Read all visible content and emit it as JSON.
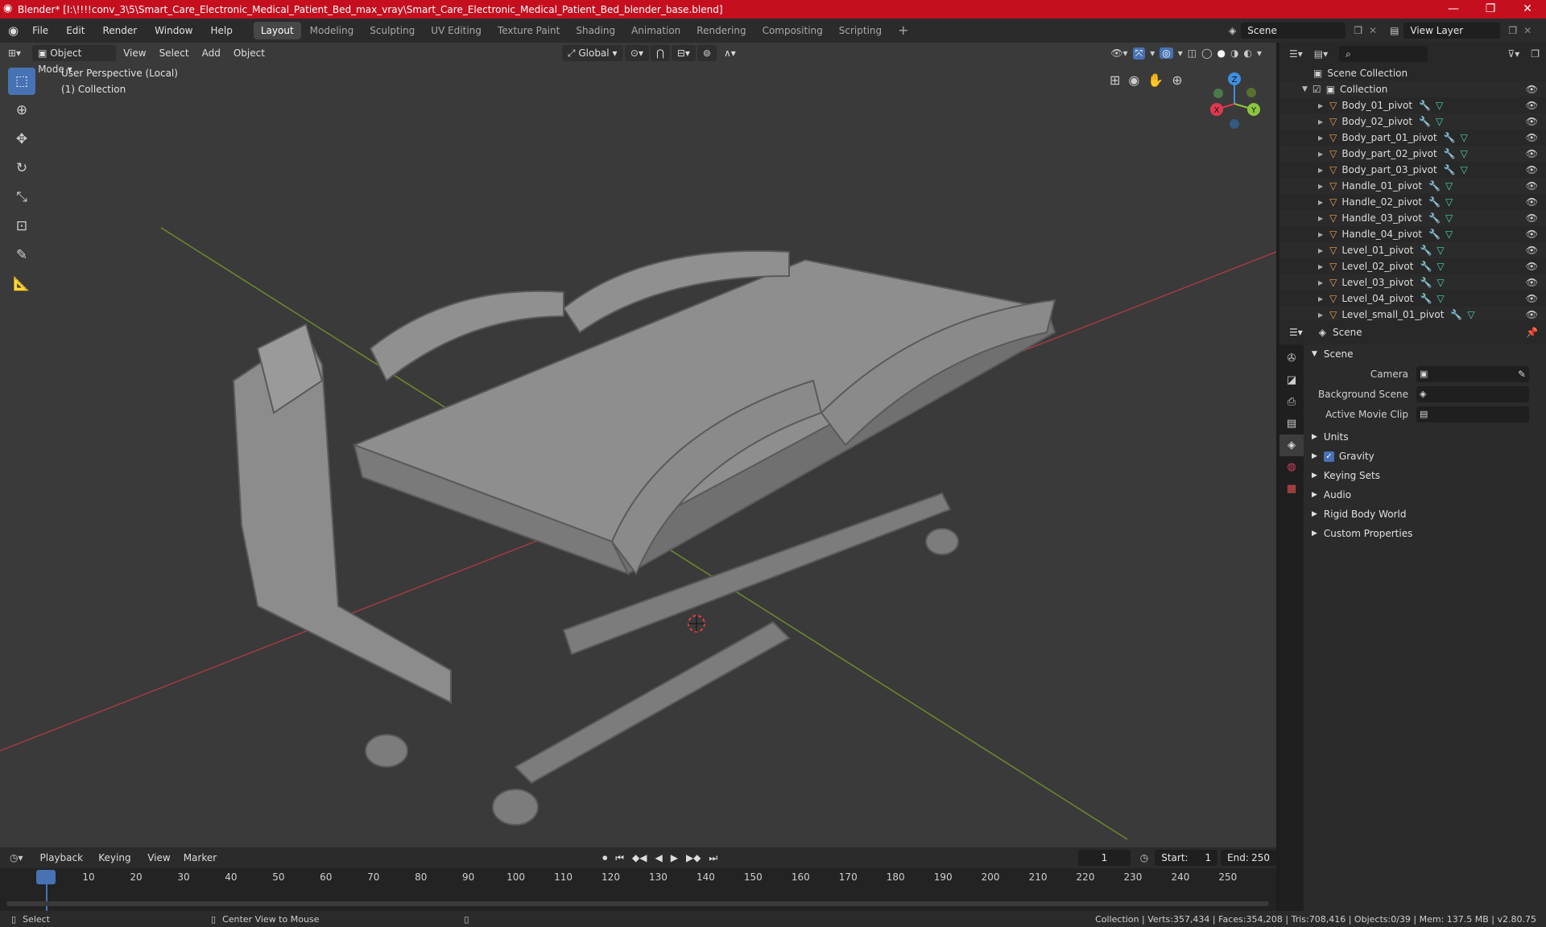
{
  "titlebar": {
    "title": "Blender* [I:\\!!!!conv_3\\5\\Smart_Care_Electronic_Medical_Patient_Bed_max_vray\\Smart_Care_Electronic_Medical_Patient_Bed_blender_base.blend]",
    "minimize": "—",
    "maximize": "❐",
    "close": "✕"
  },
  "menus": [
    "File",
    "Edit",
    "Render",
    "Window",
    "Help"
  ],
  "workspaces": [
    "Layout",
    "Modeling",
    "Sculpting",
    "UV Editing",
    "Texture Paint",
    "Shading",
    "Animation",
    "Rendering",
    "Compositing",
    "Scripting"
  ],
  "active_workspace": "Layout",
  "add_workspace": "+",
  "scene_field": "Scene",
  "view_layer_field": "View Layer",
  "viewport": {
    "mode": "Object Mode",
    "menus": [
      "View",
      "Select",
      "Add",
      "Object"
    ],
    "orientation": "Global",
    "perspective_label": "User Perspective (Local)",
    "collection_label": "(1) Collection",
    "gizmo": {
      "x": "X",
      "y": "Y",
      "z": "Z"
    }
  },
  "outliner": {
    "search_placeholder": "",
    "scene_collection": "Scene Collection",
    "collection": "Collection",
    "objects": [
      "Body_01_pivot",
      "Body_02_pivot",
      "Body_part_01_pivot",
      "Body_part_02_pivot",
      "Body_part_03_pivot",
      "Handle_01_pivot",
      "Handle_02_pivot",
      "Handle_03_pivot",
      "Handle_04_pivot",
      "Level_01_pivot",
      "Level_02_pivot",
      "Level_03_pivot",
      "Level_04_pivot",
      "Level_small_01_pivot"
    ]
  },
  "properties": {
    "header": "Scene",
    "panel": "Scene",
    "camera_label": "Camera",
    "background_scene_label": "Background Scene",
    "active_movie_clip_label": "Active Movie Clip",
    "sections": [
      "Units",
      "Gravity",
      "Keying Sets",
      "Audio",
      "Rigid Body World",
      "Custom Properties"
    ],
    "gravity_checked": true
  },
  "timeline": {
    "menus": [
      "Playback",
      "Keying",
      "View",
      "Marker"
    ],
    "current_frame": "1",
    "start_label": "Start:",
    "start": "1",
    "end_label": "End:",
    "end": "250",
    "ticks": [
      "1",
      "10",
      "20",
      "30",
      "40",
      "50",
      "60",
      "70",
      "80",
      "90",
      "100",
      "110",
      "120",
      "130",
      "140",
      "150",
      "160",
      "170",
      "180",
      "190",
      "200",
      "210",
      "220",
      "230",
      "240",
      "250"
    ]
  },
  "statusbar": {
    "select": "Select",
    "center_view": "Center View to Mouse",
    "stats": "Collection | Verts:357,434 | Faces:354,208 | Tris:708,416 | Objects:0/39 | Mem: 137.5 MB | v2.80.75"
  },
  "colors": {
    "titlebar": "#c50f1f",
    "accent": "#4772b3",
    "object_icon": "#f0a050",
    "modifier_icon": "#6aa7e8",
    "mesh_icon": "#4ad7b0",
    "axis_x": "#e0394f",
    "axis_y": "#8cc63f",
    "axis_z": "#3f8fe0"
  }
}
